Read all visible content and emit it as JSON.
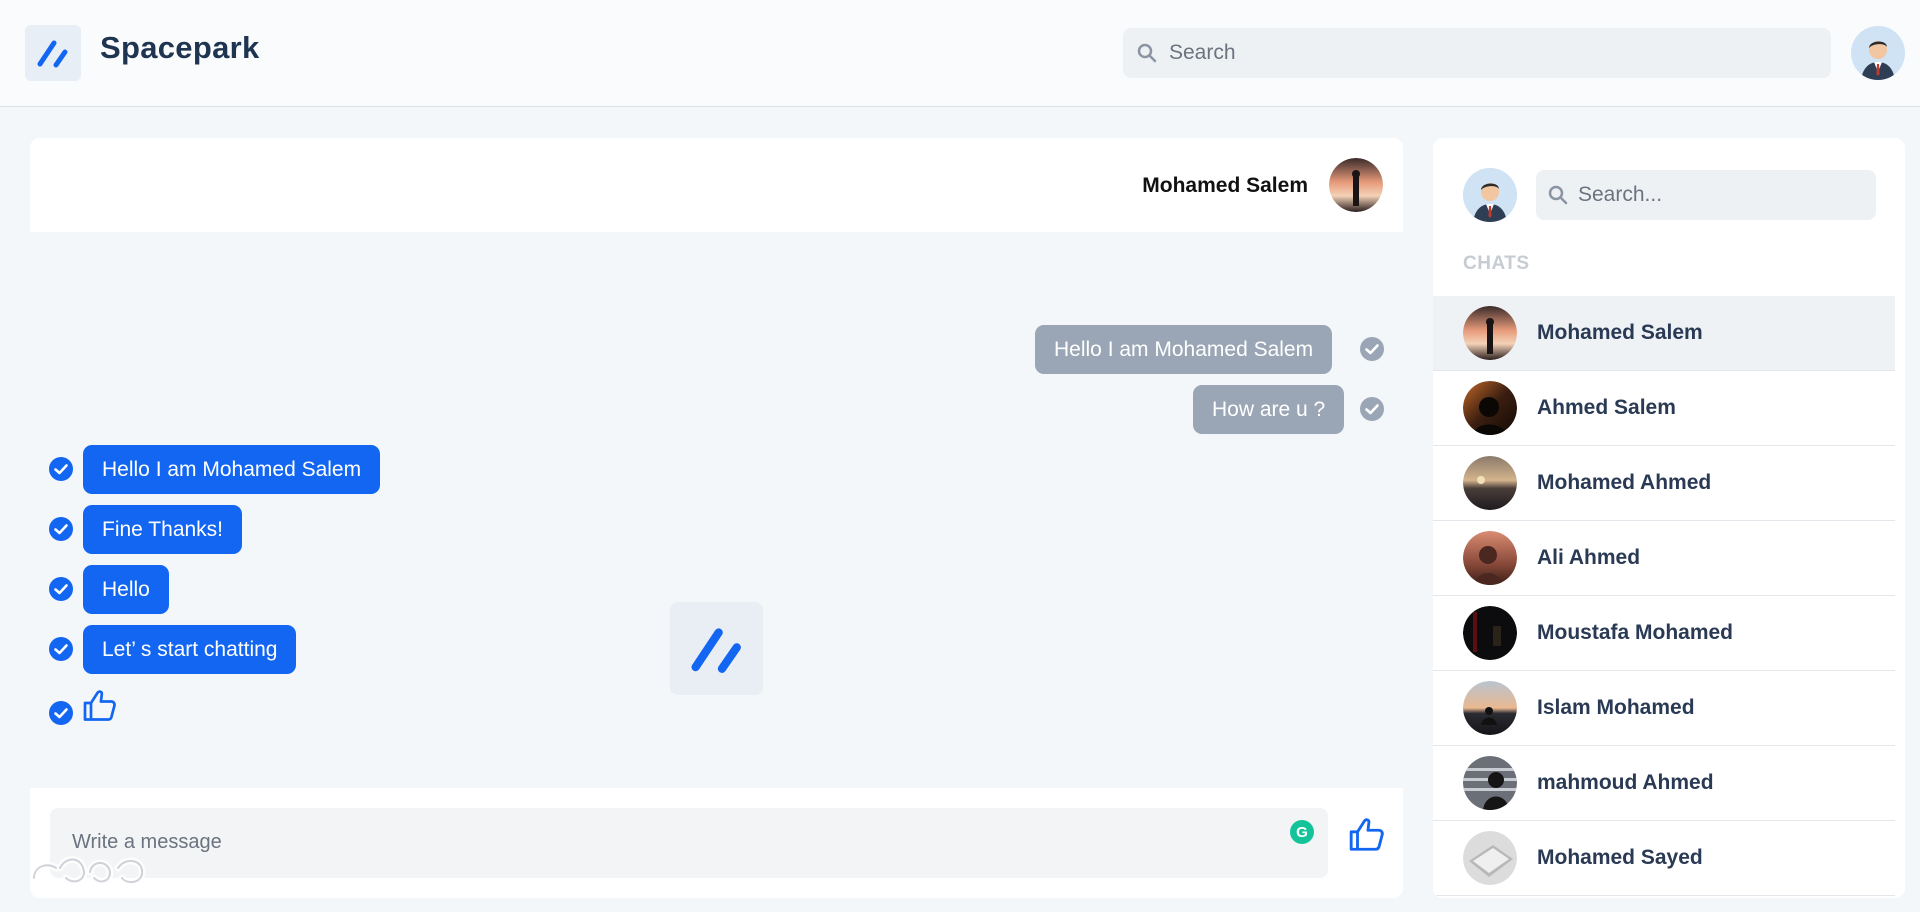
{
  "app": {
    "brand": "Spacepark",
    "search_placeholder": "Search"
  },
  "chat": {
    "contact_name": "Mohamed Salem",
    "messages_sent": [
      {
        "text": "Hello I am Mohamed Salem"
      },
      {
        "text": "How are u ?"
      }
    ],
    "messages_received": [
      {
        "text": "Hello I am Mohamed Salem"
      },
      {
        "text": "Fine Thanks!"
      },
      {
        "text": "Hello"
      },
      {
        "text": "Let’ s start chatting"
      }
    ],
    "composer_placeholder": "Write a message",
    "grammarly_letter": "G"
  },
  "sidebar": {
    "search_placeholder": "Search...",
    "heading": "CHATS",
    "chats": [
      {
        "name": "Mohamed Salem",
        "avatar": "sunset-silhouette"
      },
      {
        "name": "Ahmed Salem",
        "avatar": "dark-silhouette"
      },
      {
        "name": "Mohamed Ahmed",
        "avatar": "beach-sunset"
      },
      {
        "name": "Ali Ahmed",
        "avatar": "woman-silhouette"
      },
      {
        "name": "Moustafa Mohamed",
        "avatar": "night-silhouette"
      },
      {
        "name": "Islam Mohamed",
        "avatar": "sunset-sitting"
      },
      {
        "name": "mahmoud Ahmed",
        "avatar": "window-silhouette"
      },
      {
        "name": "Mohamed Sayed",
        "avatar": "laptop"
      }
    ]
  },
  "colors": {
    "primary": "#1266f1",
    "sent_bubble": "#9aa6b5",
    "brand_text": "#1f3450"
  }
}
